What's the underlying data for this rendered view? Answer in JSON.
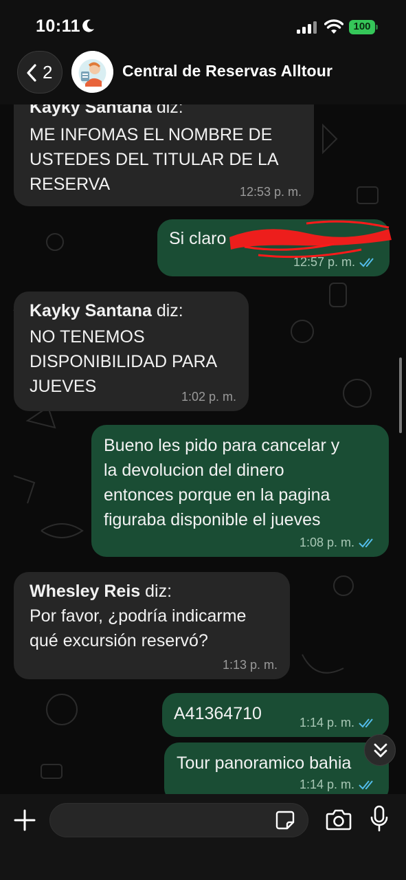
{
  "status_bar": {
    "time": "10:11",
    "battery": "100"
  },
  "header": {
    "back_count": "2",
    "contact_name": "Central de Reservas Alltour"
  },
  "messages": [
    {
      "direction": "in",
      "sender": "Kayky Santana",
      "sender_suffix": " diz:",
      "text": "ME INFOMAS EL NOMBRE DE\nUSTEDES DEL TITULAR DE LA\nRESERVA",
      "time": "12:53 p. m."
    },
    {
      "direction": "out",
      "text": "Si claro",
      "time": "12:57 p. m.",
      "redacted": true
    },
    {
      "direction": "in",
      "sender": "Kayky Santana",
      "sender_suffix": " diz:",
      "text": "NO TENEMOS\nDISPONIBILIDAD PARA\nJUEVES",
      "time": "1:02 p. m."
    },
    {
      "direction": "out",
      "text": "Bueno les pido para cancelar y\nla devolucion del dinero\nentonces porque en la pagina\nfiguraba disponible el jueves",
      "time": "1:08 p. m."
    },
    {
      "direction": "in",
      "sender": "Whesley Reis",
      "sender_suffix": " diz:",
      "text": "Por favor, ¿podría indicarme\nqué excursión reservó?",
      "time": "1:13 p. m."
    },
    {
      "direction": "out",
      "text": "A41364710",
      "time": "1:14 p. m."
    },
    {
      "direction": "out",
      "text": "Tour panoramico bahia",
      "time": "1:14 p. m."
    }
  ],
  "input": {
    "placeholder": ""
  },
  "icons": {
    "back": "chevron-left-icon",
    "moon": "moon-icon",
    "signal": "signal-icon",
    "wifi": "wifi-icon",
    "plus": "plus-icon",
    "sticker": "sticker-icon",
    "camera": "camera-icon",
    "mic": "microphone-icon",
    "scroll_down": "double-chevron-down-icon",
    "read_receipt": "double-check-icon"
  },
  "colors": {
    "incoming_bubble": "#262626",
    "outgoing_bubble": "#1a4d34",
    "read_ticks": "#53bdeb",
    "battery": "#35c759",
    "redaction": "#ff1a1a"
  }
}
